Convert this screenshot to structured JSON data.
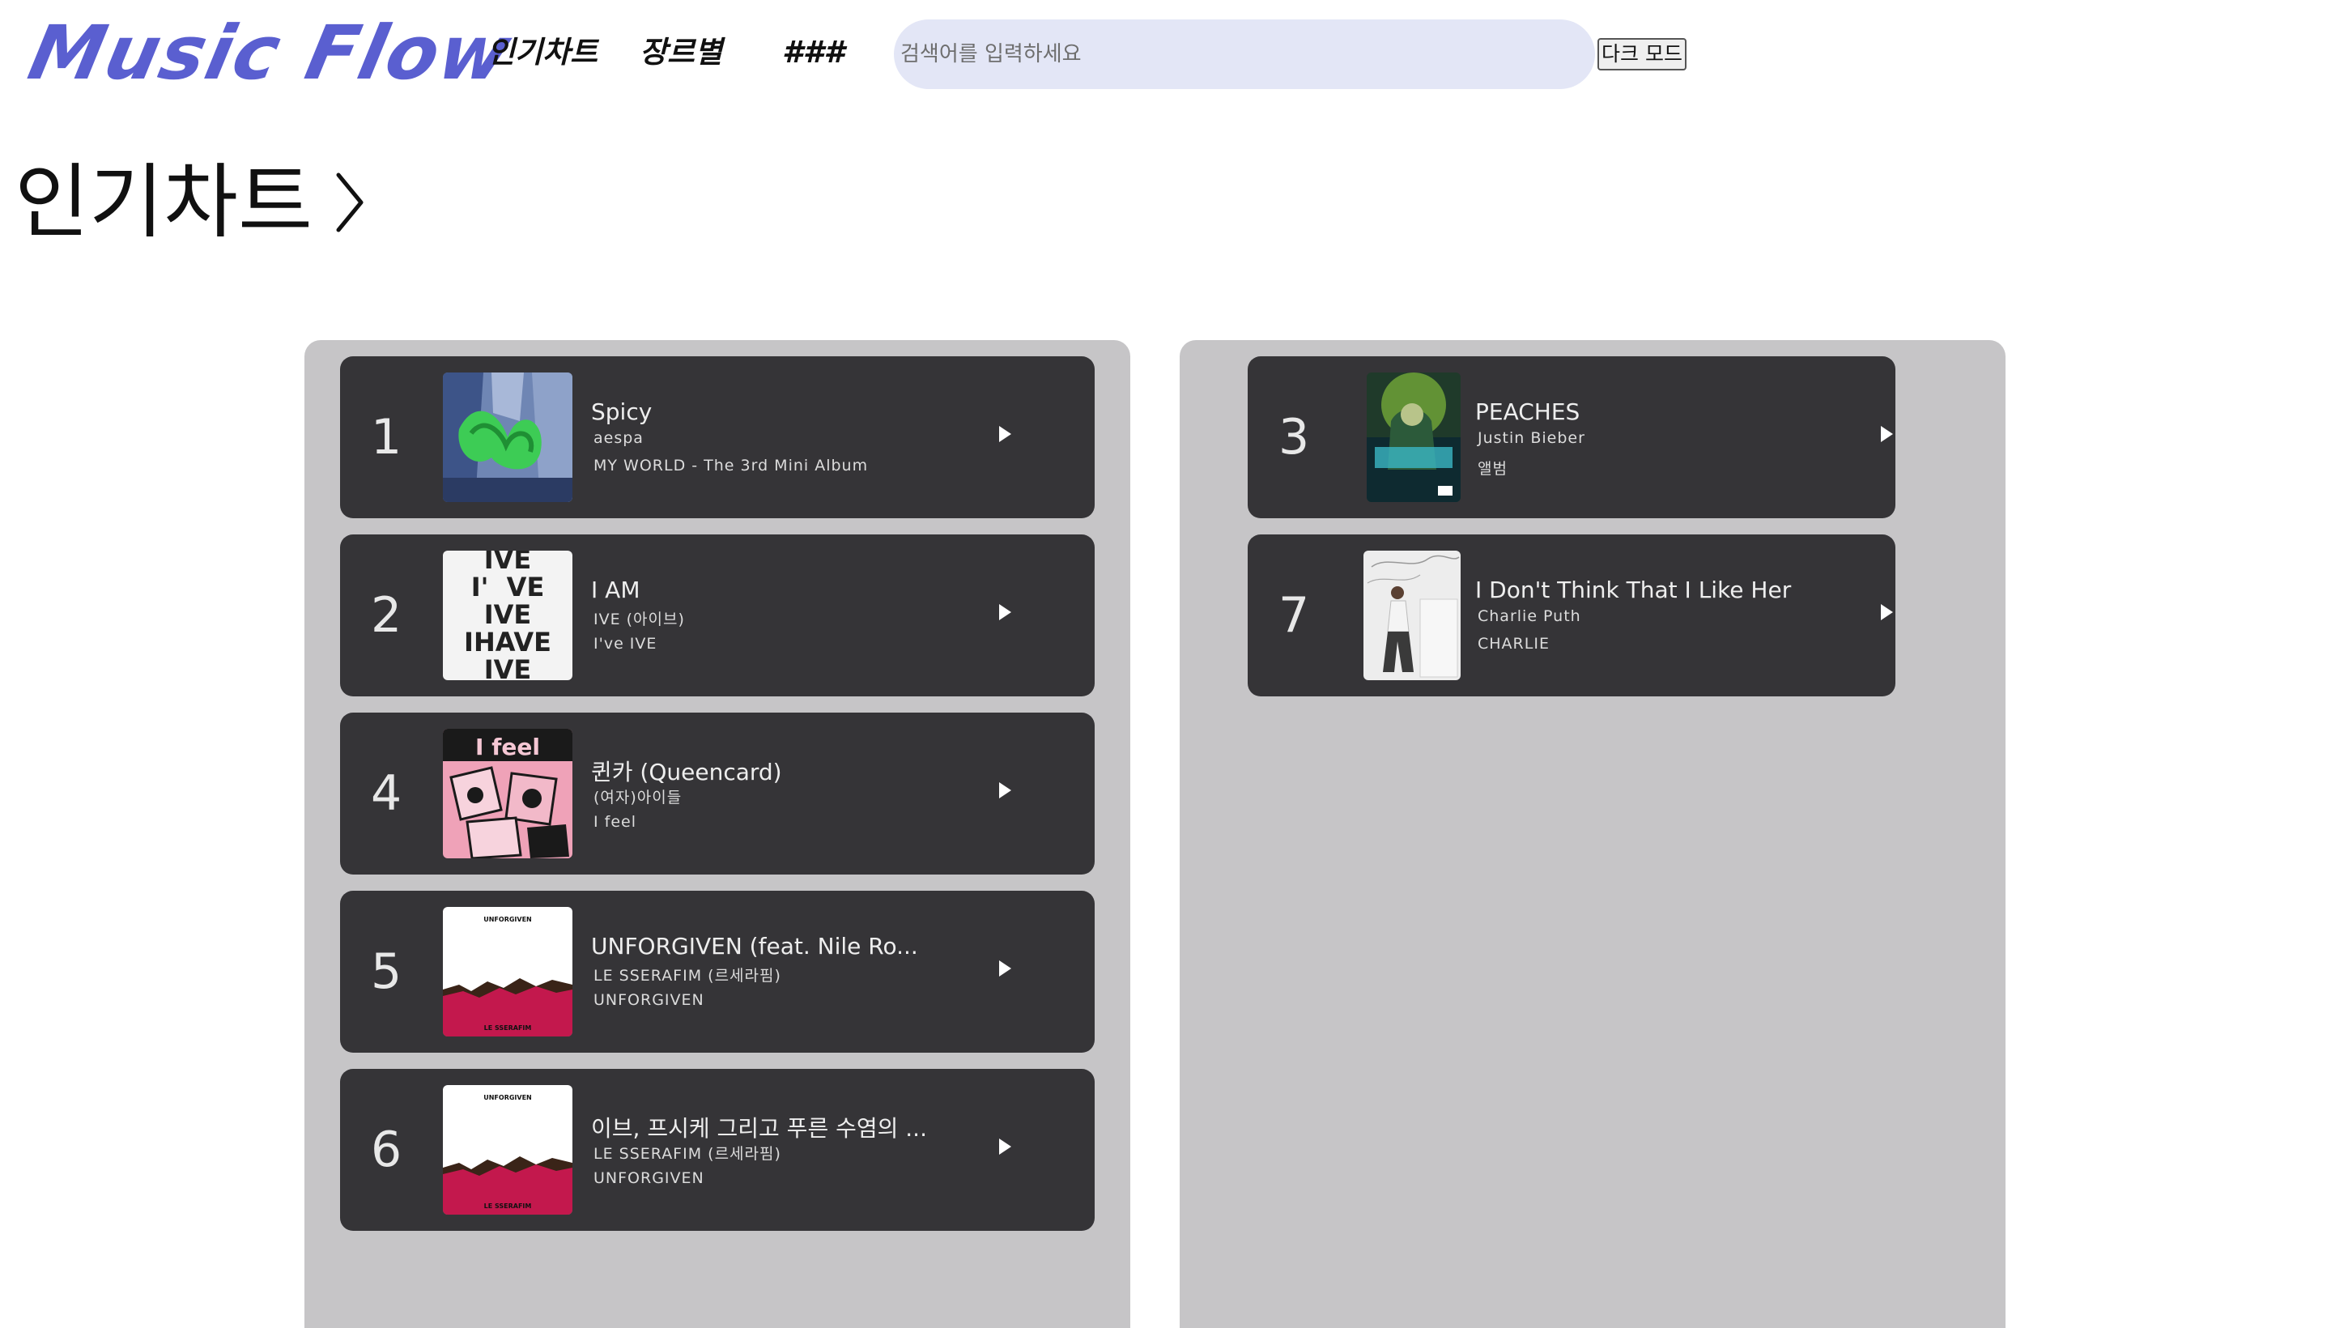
{
  "header": {
    "logo": "Music Flow",
    "nav": [
      "인기차트",
      "장르별",
      "###"
    ],
    "search_placeholder": "검색어를 입력하세요",
    "mode_button": "다크 모드"
  },
  "page_title": "인기차트",
  "icons": {
    "title_chevron": "chevron-right-icon",
    "play": "play-icon"
  },
  "colors": {
    "logo": "#5a5fd0",
    "search_bg": "#e3e6f6",
    "panel_bg": "#c6c5c7",
    "card_bg": "#353437"
  },
  "left_column": [
    {
      "rank": "1",
      "title": "Spicy",
      "artist": "aespa",
      "album": "MY WORLD - The 3rd Mini Album"
    },
    {
      "rank": "2",
      "title": "I AM",
      "artist": "IVE (아이브)",
      "album": "I've IVE"
    },
    {
      "rank": "4",
      "title": "퀸카 (Queencard)",
      "artist": "(여자)아이들",
      "album": "I feel"
    },
    {
      "rank": "5",
      "title": "UNFORGIVEN (feat. Nile Ro...",
      "artist": "LE SSERAFIM (르세라핌)",
      "album": "UNFORGIVEN"
    },
    {
      "rank": "6",
      "title": "이브, 프시케 그리고 푸른 수염의 ...",
      "artist": "LE SSERAFIM (르세라핌)",
      "album": "UNFORGIVEN"
    }
  ],
  "right_column": [
    {
      "rank": "3",
      "title": "PEACHES",
      "artist": "Justin Bieber",
      "album": "앨범"
    },
    {
      "rank": "7",
      "title": "I Don't Think That I Like Her",
      "artist": "Charlie Puth",
      "album": "CHARLIE"
    }
  ],
  "cover_art_text": {
    "ive": [
      "IVE",
      "I'  VE",
      "IVE",
      "IHAVE",
      "IVE"
    ],
    "ifeel": "I feel",
    "unforgiven_top": "UNFORGIVEN",
    "unforgiven_bottom": "LE SSERAFIM"
  }
}
